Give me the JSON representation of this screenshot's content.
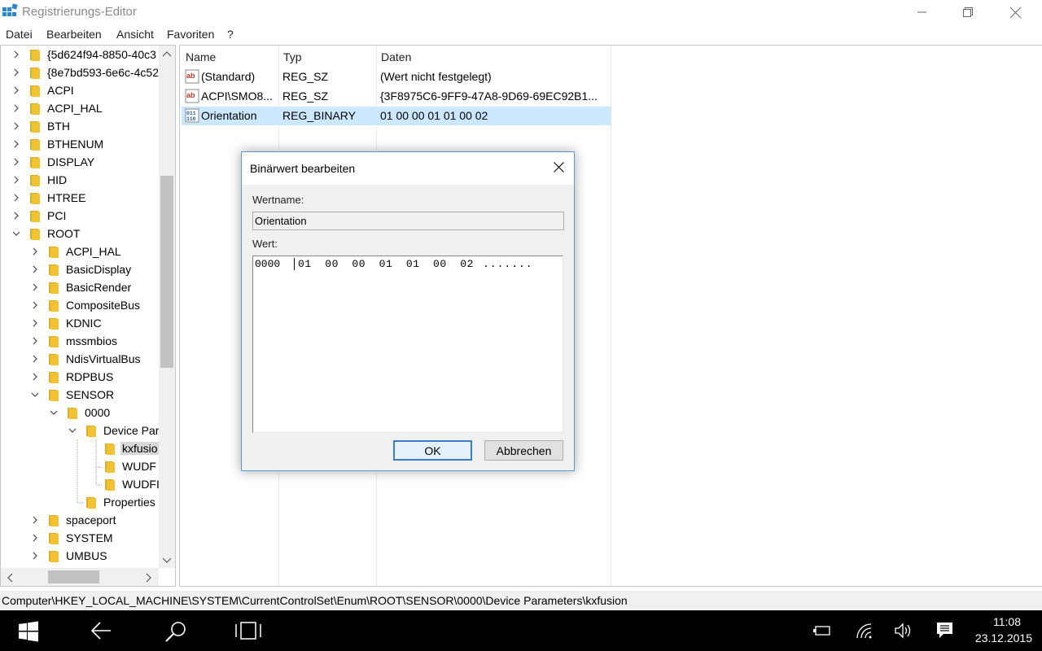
{
  "window": {
    "title": "Registrierungs-Editor"
  },
  "menu": [
    "Datei",
    "Bearbeiten",
    "Ansicht",
    "Favoriten",
    "?"
  ],
  "tree": [
    {
      "label": "{5d624f94-8850-40c3",
      "chevron": "right",
      "indent": 0
    },
    {
      "label": "{8e7bd593-6e6c-4c52",
      "chevron": "right",
      "indent": 0
    },
    {
      "label": "ACPI",
      "chevron": "right",
      "indent": 0
    },
    {
      "label": "ACPI_HAL",
      "chevron": "right",
      "indent": 0
    },
    {
      "label": "BTH",
      "chevron": "right",
      "indent": 0
    },
    {
      "label": "BTHENUM",
      "chevron": "right",
      "indent": 0
    },
    {
      "label": "DISPLAY",
      "chevron": "right",
      "indent": 0
    },
    {
      "label": "HID",
      "chevron": "right",
      "indent": 0
    },
    {
      "label": "HTREE",
      "chevron": "right",
      "indent": 0
    },
    {
      "label": "PCI",
      "chevron": "right",
      "indent": 0
    },
    {
      "label": "ROOT",
      "chevron": "down",
      "indent": 0
    },
    {
      "label": "ACPI_HAL",
      "chevron": "right",
      "indent": 1
    },
    {
      "label": "BasicDisplay",
      "chevron": "right",
      "indent": 1
    },
    {
      "label": "BasicRender",
      "chevron": "right",
      "indent": 1
    },
    {
      "label": "CompositeBus",
      "chevron": "right",
      "indent": 1
    },
    {
      "label": "KDNIC",
      "chevron": "right",
      "indent": 1
    },
    {
      "label": "mssmbios",
      "chevron": "right",
      "indent": 1
    },
    {
      "label": "NdisVirtualBus",
      "chevron": "right",
      "indent": 1
    },
    {
      "label": "RDPBUS",
      "chevron": "right",
      "indent": 1
    },
    {
      "label": "SENSOR",
      "chevron": "down",
      "indent": 1
    },
    {
      "label": "0000",
      "chevron": "down",
      "indent": 2
    },
    {
      "label": "Device Par",
      "chevron": "down",
      "indent": 3
    },
    {
      "label": "kxfusio",
      "chevron": "none",
      "indent": 4,
      "selected": true
    },
    {
      "label": "WUDF",
      "chevron": "none",
      "indent": 4
    },
    {
      "label": "WUDFI",
      "chevron": "none",
      "indent": 4
    },
    {
      "label": "Properties",
      "chevron": "none",
      "indent": 3
    },
    {
      "label": "spaceport",
      "chevron": "right",
      "indent": 1
    },
    {
      "label": "SYSTEM",
      "chevron": "right",
      "indent": 1
    },
    {
      "label": "UMBUS",
      "chevron": "right",
      "indent": 1
    }
  ],
  "list": {
    "headers": {
      "name": "Name",
      "type": "Typ",
      "data": "Daten"
    },
    "rows": [
      {
        "icon": "string-value-icon",
        "name": "(Standard)",
        "type": "REG_SZ",
        "data": "(Wert nicht festgelegt)"
      },
      {
        "icon": "string-value-icon",
        "name": "ACPI\\SMO8...",
        "type": "REG_SZ",
        "data": "{3F8975C6-9FF9-47A8-9D69-69EC92B1..."
      },
      {
        "icon": "binary-value-icon",
        "name": "Orientation",
        "type": "REG_BINARY",
        "data": "01 00 00 01 01 00 02",
        "selected": true
      }
    ]
  },
  "status": {
    "path": "Computer\\HKEY_LOCAL_MACHINE\\SYSTEM\\CurrentControlSet\\Enum\\ROOT\\SENSOR\\0000\\Device Parameters\\kxfusion"
  },
  "dialog": {
    "title": "Binärwert bearbeiten",
    "name_label": "Wertname:",
    "name_value": "Orientation",
    "value_label": "Wert:",
    "hex_offset": "0000",
    "hex_bytes": "01 00 00 01 01 00 02",
    "hex_ascii": ".......",
    "ok_label": "OK",
    "cancel_label": "Abbrechen"
  },
  "taskbar": {
    "time": "11:08",
    "date": "23.12.2015"
  },
  "colors": {
    "selection": "#cce8ff",
    "dialog_border": "#5a9bd5",
    "folder": "#f1c232"
  }
}
